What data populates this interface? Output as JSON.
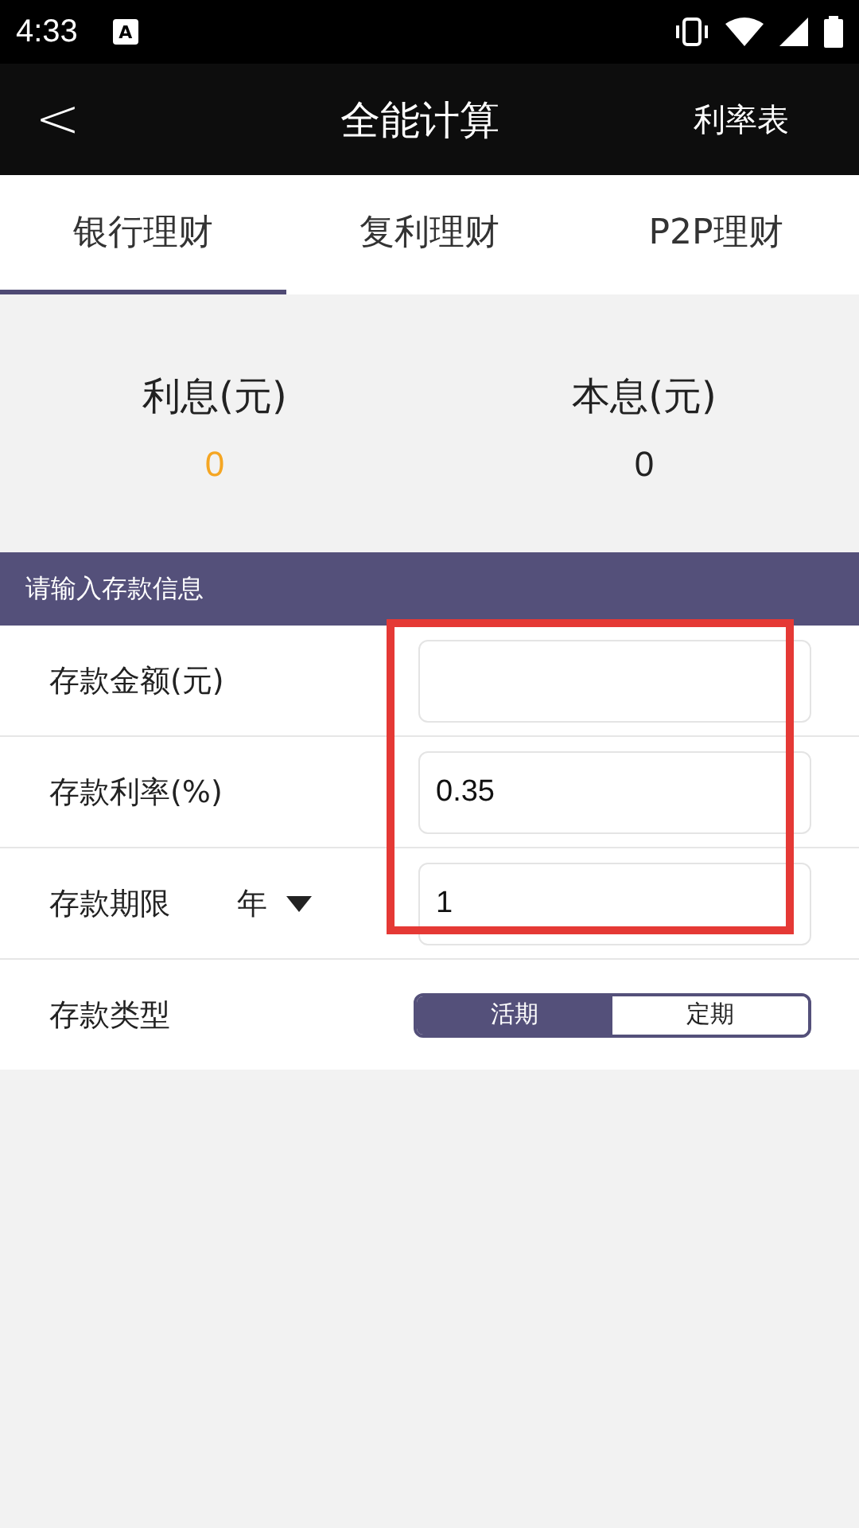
{
  "status_bar": {
    "time": "4:33",
    "notification": "A"
  },
  "header": {
    "back": "<",
    "title": "全能计算",
    "action": "利率表"
  },
  "tabs": [
    {
      "label": "银行理财",
      "selected": true
    },
    {
      "label": "复利理财",
      "selected": false
    },
    {
      "label": "P2P理财",
      "selected": false
    }
  ],
  "results": [
    {
      "label": "利息(元)",
      "value": "0",
      "kind": "highlight"
    },
    {
      "label": "本息(元)",
      "value": "0",
      "kind": "plain"
    }
  ],
  "section_title": "请输入存款信息",
  "rows": [
    {
      "kind": "input",
      "label": "存款金额(元)",
      "value": ""
    },
    {
      "kind": "input",
      "label": "存款利率(%)",
      "value": "0.35"
    },
    {
      "kind": "period",
      "label": "存款期限",
      "unit": "年",
      "value": "1"
    },
    {
      "kind": "toggle",
      "label": "存款类型",
      "options": [
        {
          "label": "活期",
          "selected": true
        },
        {
          "label": "定期",
          "selected": false
        }
      ]
    }
  ],
  "annotation": {
    "kind": "rectangle"
  }
}
